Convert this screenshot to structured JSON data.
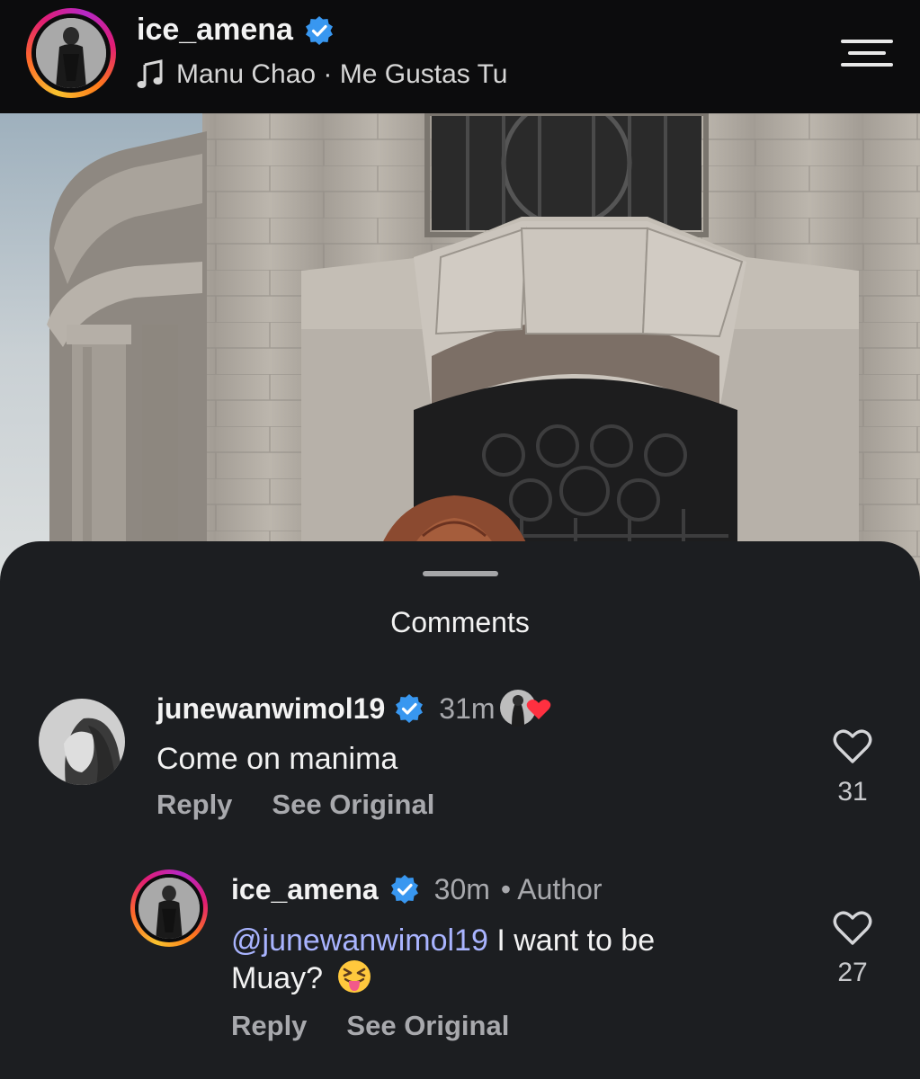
{
  "header": {
    "username": "ice_amena",
    "music": "Manu Chao · Me Gustas Tu",
    "verified_color": "#3897f0",
    "icons": [
      "verified-badge-icon",
      "music-note-icon",
      "menu-icon"
    ]
  },
  "sheet": {
    "title": "Comments"
  },
  "comments": [
    {
      "username": "junewanwimol19",
      "time": "31m",
      "text": "Come on manima",
      "reply_label": "Reply",
      "see_original_label": "See Original",
      "likes": "31",
      "liked_by_author": true
    },
    {
      "username": "ice_amena",
      "time": "30m",
      "author_badge": "• Author",
      "mention": "@junewanwimol19",
      "text_line1": " I want to be",
      "text_line2": "Muay?",
      "emoji": "squinting-face-with-tongue",
      "reply_label": "Reply",
      "see_original_label": "See Original",
      "likes": "27"
    }
  ],
  "colors": {
    "background": "#1c1e21",
    "mention": "#a9b4ff",
    "secondary_text": "#a8a9ad",
    "heart_red": "#ff3040"
  }
}
